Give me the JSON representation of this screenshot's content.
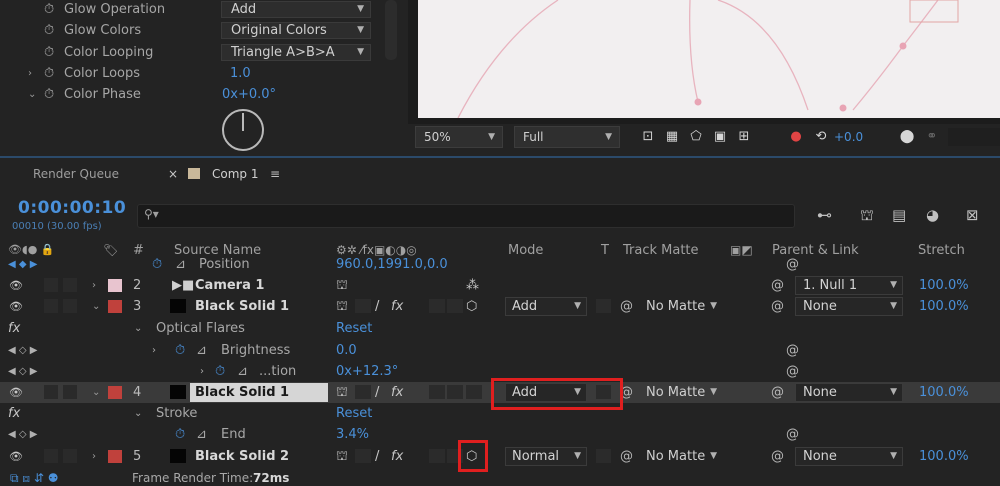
{
  "effect_controls": {
    "rows": [
      {
        "label": "Glow Operation",
        "dropdown": "Add"
      },
      {
        "label": "Glow Colors",
        "dropdown": "Original Colors"
      },
      {
        "label": "Color Looping",
        "dropdown": "Triangle A>B>A"
      },
      {
        "label": "Color Loops",
        "value": "1.0"
      },
      {
        "label": "Color Phase",
        "value": "0x+0.0°"
      }
    ]
  },
  "viewer": {
    "zoom": "50%",
    "resolution": "Full",
    "exposure": "+0.0"
  },
  "timeline": {
    "tabs": {
      "render_queue": "Render Queue",
      "comp": "Comp 1"
    },
    "timecode": "0:00:00:10",
    "frames": "00010 (30.00 fps)",
    "search_placeholder": "",
    "headers": {
      "num": "#",
      "source_name": "Source Name",
      "mode": "Mode",
      "t": "T",
      "track_matte": "Track Matte",
      "parent_link": "Parent & Link",
      "stretch": "Stretch"
    },
    "position_row": {
      "label": "Position",
      "value": "960.0,1991.0,0.0"
    },
    "layers": [
      {
        "num": "2",
        "name": "Camera 1",
        "parent": "1. Null 1",
        "stretch": "100.0%",
        "label_color": "#e8c4cf"
      },
      {
        "num": "3",
        "name": "Black Solid 1",
        "mode": "Add",
        "track_matte": "No Matte",
        "parent": "None",
        "stretch": "100.0%",
        "label_color": "#c0413c"
      },
      {
        "num": "4",
        "name": "Black Solid 1",
        "mode": "Add",
        "track_matte": "No Matte",
        "parent": "None",
        "stretch": "100.0%",
        "label_color": "#c0413c"
      },
      {
        "num": "5",
        "name": "Black Solid 2",
        "mode": "Normal",
        "track_matte": "No Matte",
        "parent": "None",
        "stretch": "100.0%",
        "label_color": "#c0413c"
      }
    ],
    "optical_flares": {
      "label": "Optical Flares",
      "reset": "Reset"
    },
    "brightness": {
      "label": "Brightness",
      "value": "0.0"
    },
    "rotation": {
      "label": "...tion",
      "value": "0x+12.3°"
    },
    "stroke": {
      "label": "Stroke",
      "reset": "Reset"
    },
    "end": {
      "label": "End",
      "value": "3.4%"
    },
    "fx_label": "fx",
    "status_label": "Frame Render Time:",
    "status_value": "72ms"
  }
}
